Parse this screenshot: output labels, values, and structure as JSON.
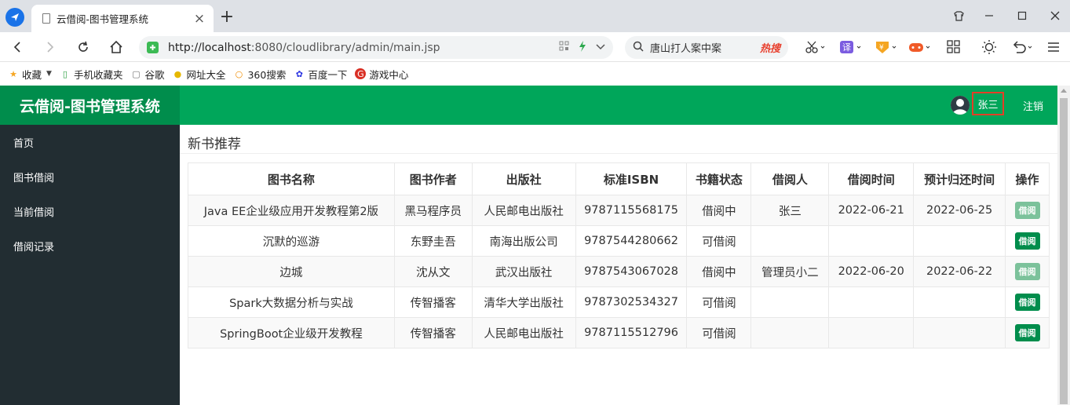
{
  "browser": {
    "tab_title": "云借阅-图书管理系统",
    "tab_close": "×",
    "new_tab": "+",
    "url_host": "http://localhost",
    "url_rest": ":8080/cloudlibrary/admin/main.jsp",
    "search_text": "唐山打人案中案",
    "hot_label": "热搜",
    "bookmarks": [
      {
        "label": "收藏",
        "icon": "star-icon",
        "color": "#f5a623"
      },
      {
        "label": "手机收藏夹",
        "icon": "phone-icon",
        "color": "#2ea043"
      },
      {
        "label": "谷歌",
        "icon": "page-icon",
        "color": "#777777"
      },
      {
        "label": "网址大全",
        "icon": "360-icon",
        "color": "#e6b800"
      },
      {
        "label": "360搜索",
        "icon": "360so-icon",
        "color": "#f08c00"
      },
      {
        "label": "百度一下",
        "icon": "baidu-icon",
        "color": "#2932e1"
      },
      {
        "label": "游戏中心",
        "icon": "game-icon",
        "color": "#d93025"
      }
    ]
  },
  "app": {
    "logo": "云借阅-图书管理系统",
    "user_name": "张三",
    "logout": "注销",
    "accent": "#00a65a",
    "sidebar": [
      "首页",
      "图书借阅",
      "当前借阅",
      "借阅记录"
    ],
    "section_title": "新书推荐",
    "columns": [
      "图书名称",
      "图书作者",
      "出版社",
      "标准ISBN",
      "书籍状态",
      "借阅人",
      "借阅时间",
      "预计归还时间",
      "操作"
    ],
    "rows": [
      {
        "name": "Java EE企业级应用开发教程第2版",
        "author": "黑马程序员",
        "press": "人民邮电出版社",
        "isbn": "9787115568175",
        "status": "借阅中",
        "borrower": "张三",
        "borrow_time": "2022-06-21",
        "return_time": "2022-06-25",
        "action": "借阅",
        "action_enabled": false
      },
      {
        "name": "沉默的巡游",
        "author": "东野圭吾",
        "press": "南海出版公司",
        "isbn": "9787544280662",
        "status": "可借阅",
        "borrower": "",
        "borrow_time": "",
        "return_time": "",
        "action": "借阅",
        "action_enabled": true
      },
      {
        "name": "边城",
        "author": "沈从文",
        "press": "武汉出版社",
        "isbn": "9787543067028",
        "status": "借阅中",
        "borrower": "管理员小二",
        "borrow_time": "2022-06-20",
        "return_time": "2022-06-22",
        "action": "借阅",
        "action_enabled": false
      },
      {
        "name": "Spark大数据分析与实战",
        "author": "传智播客",
        "press": "清华大学出版社",
        "isbn": "9787302534327",
        "status": "可借阅",
        "borrower": "",
        "borrow_time": "",
        "return_time": "",
        "action": "借阅",
        "action_enabled": true
      },
      {
        "name": "SpringBoot企业级开发教程",
        "author": "传智播客",
        "press": "人民邮电出版社",
        "isbn": "9787115512796",
        "status": "可借阅",
        "borrower": "",
        "borrow_time": "",
        "return_time": "",
        "action": "借阅",
        "action_enabled": true
      }
    ]
  }
}
